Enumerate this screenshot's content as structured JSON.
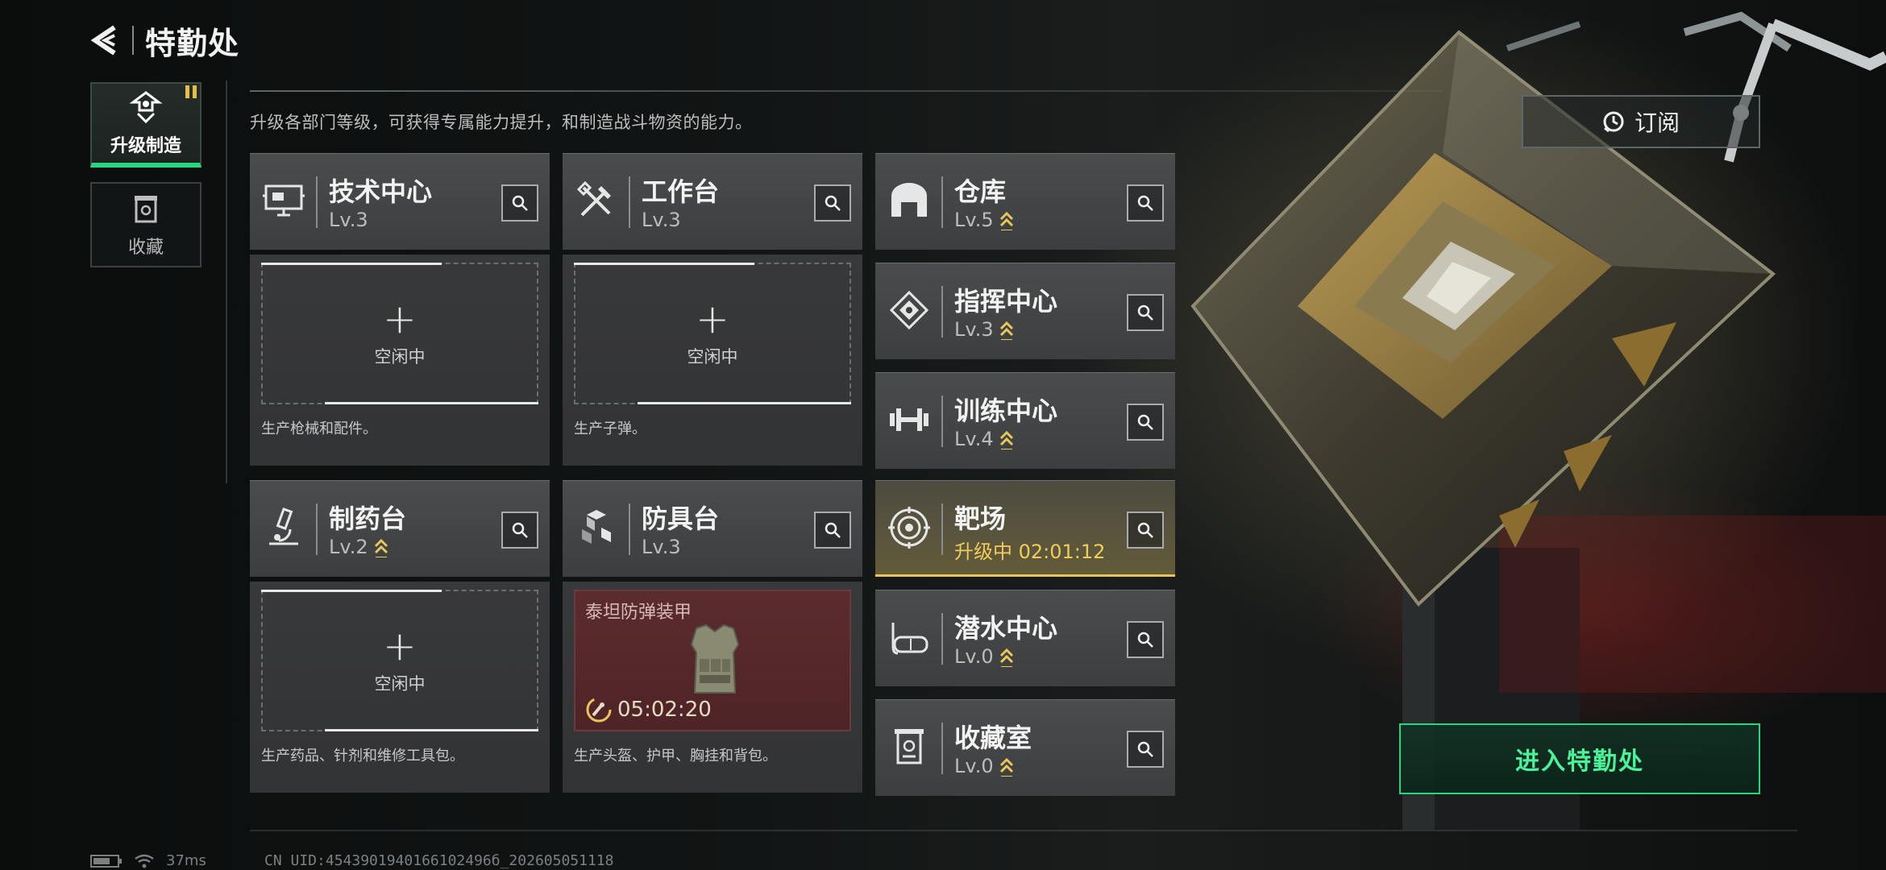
{
  "header": {
    "title": "特勤处"
  },
  "side_tabs": [
    {
      "label": "升级制造",
      "active": true
    },
    {
      "label": "收藏",
      "active": false
    }
  ],
  "subtitle": "升级各部门等级，可获得专属能力提升，和制造战斗物资的能力。",
  "subscribe_label": "订阅",
  "enter_label": "进入特勤处",
  "production": [
    {
      "name": "技术中心",
      "level": "Lv.3",
      "slot_label": "空闲中",
      "plus": "+",
      "desc": "生产枪械和配件。"
    },
    {
      "name": "工作台",
      "level": "Lv.3",
      "slot_label": "空闲中",
      "plus": "+",
      "desc": "生产子弹。"
    },
    {
      "name": "制药台",
      "level": "Lv.2",
      "slot_label": "空闲中",
      "plus": "+",
      "desc": "生产药品、针剂和维修工具包。"
    },
    {
      "name": "防具台",
      "level": "Lv.3",
      "active_item": "泰坦防弹装甲",
      "active_timer": "05:02:20",
      "desc": "生产头盔、护甲、胸挂和背包。"
    }
  ],
  "facilities": [
    {
      "name": "仓库",
      "level": "Lv.5"
    },
    {
      "name": "指挥中心",
      "level": "Lv.3"
    },
    {
      "name": "训练中心",
      "level": "Lv.4"
    },
    {
      "name": "靶场",
      "level": "升级中 02:01:12"
    },
    {
      "name": "潜水中心",
      "level": "Lv.0"
    },
    {
      "name": "收藏室",
      "level": "Lv.0"
    }
  ],
  "status": {
    "ping": "37ms",
    "uid": "CN UID:4543901940166102496б_202605051118"
  },
  "colors": {
    "accent_green": "#27d67f",
    "upgrade_gold": "#e8c65a",
    "card_bg": "#4a4c4d"
  }
}
